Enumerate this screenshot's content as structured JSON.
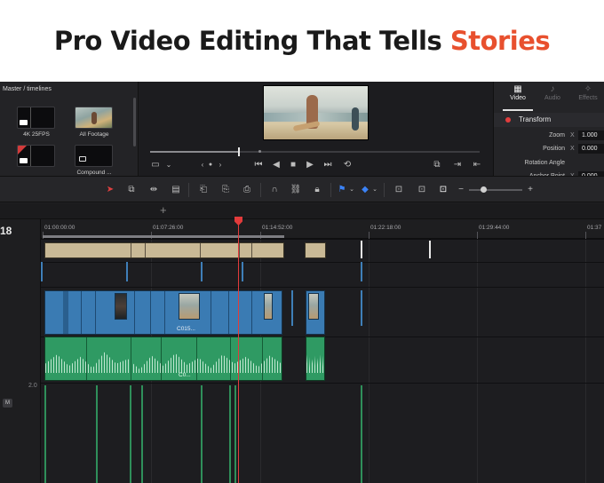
{
  "banner": {
    "headline_main": "Pro Video Editing That Tells ",
    "headline_accent": "Stories",
    "accent_color": "#e8502e"
  },
  "media_pool": {
    "breadcrumb": "Master / timelines",
    "items": [
      {
        "label": "4K 25FPS",
        "icon": "timeline-icon"
      },
      {
        "label": "All Footage",
        "icon": "footage-thumbnail"
      },
      {
        "label": "",
        "icon": "timeline-icon"
      },
      {
        "label": "Compound ...",
        "icon": "compound-clip-icon"
      }
    ]
  },
  "viewer": {
    "transport_icons": [
      "crop-icon",
      "chevron-down-icon",
      "prev-marker-icon",
      "next-marker-icon",
      "skip-to-start-icon",
      "reverse-play-icon",
      "stop-icon",
      "play-icon",
      "skip-to-end-icon",
      "loop-icon",
      "match-frame-icon",
      "in-point-icon",
      "out-point-icon"
    ]
  },
  "inspector": {
    "tabs": [
      {
        "label": "Video",
        "icon": "film-icon",
        "active": true
      },
      {
        "label": "Audio",
        "icon": "music-note-icon",
        "active": false
      },
      {
        "label": "Effects",
        "icon": "magic-wand-icon",
        "active": false
      }
    ],
    "section": "Transform",
    "properties": [
      {
        "label": "Zoom",
        "axis": "X",
        "value": "1.000"
      },
      {
        "label": "Position",
        "axis": "X",
        "value": "0.000"
      },
      {
        "label": "Rotation Angle",
        "axis": "",
        "value": ""
      },
      {
        "label": "Anchor Point",
        "axis": "X",
        "value": "0.000"
      }
    ]
  },
  "toolbar": {
    "tools": [
      "selection-tool-icon",
      "trim-tool-icon",
      "dynamic-trim-icon",
      "blade-tool-icon",
      "insert-clip-icon",
      "overwrite-clip-icon",
      "replace-clip-icon",
      "snapping-icon",
      "linked-selection-icon",
      "position-lock-icon",
      "flag-icon",
      "marker-icon",
      "zoom-full-icon",
      "zoom-detail-icon",
      "zoom-custom-icon",
      "zoom-out-icon",
      "zoom-in-icon"
    ]
  },
  "timeline": {
    "current_timecode_fragment": "18",
    "ruler_labels": [
      "01:00:00:00",
      "01:07:26:00",
      "01:14:52:00",
      "01:22:18:00",
      "01:29:44:00",
      "01:37"
    ],
    "video_clip_labels": [
      "C015...",
      "C0..."
    ],
    "audio_level": "2.0",
    "track_button": "M",
    "playhead_color": "#e23b3b"
  }
}
